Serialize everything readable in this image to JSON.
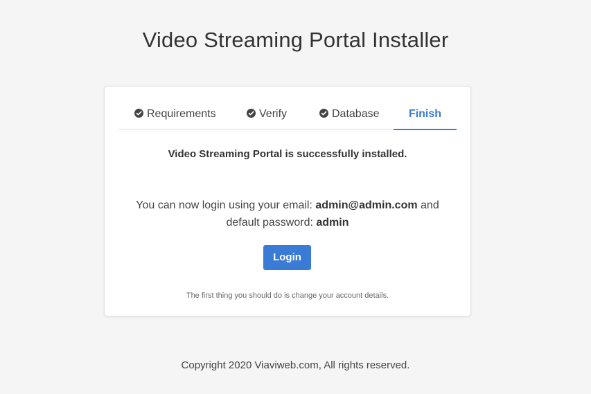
{
  "header": {
    "title": "Video Streaming Portal Installer"
  },
  "tabs": [
    {
      "label": "Requirements",
      "completed": true,
      "icon": "check-circle-icon"
    },
    {
      "label": "Verify",
      "completed": true,
      "icon": "check-circle-icon"
    },
    {
      "label": "Database",
      "completed": true,
      "icon": "check-circle-icon"
    },
    {
      "label": "Finish",
      "completed": false,
      "active": true
    }
  ],
  "content": {
    "success_message": "Video Streaming Portal is successfully installed.",
    "login_prefix": "You can now login using your email:",
    "email": "admin@admin.com",
    "login_middle": "and",
    "password_prefix": "default password:",
    "password": "admin",
    "login_button": "Login",
    "hint": "The first thing you should do is change your account details."
  },
  "footer": {
    "copyright": "Copyright 2020 Viaviweb.com, All rights reserved."
  },
  "colors": {
    "accent": "#3a7bd5",
    "background": "#f5f5f5",
    "card": "#ffffff",
    "text": "#333333"
  }
}
